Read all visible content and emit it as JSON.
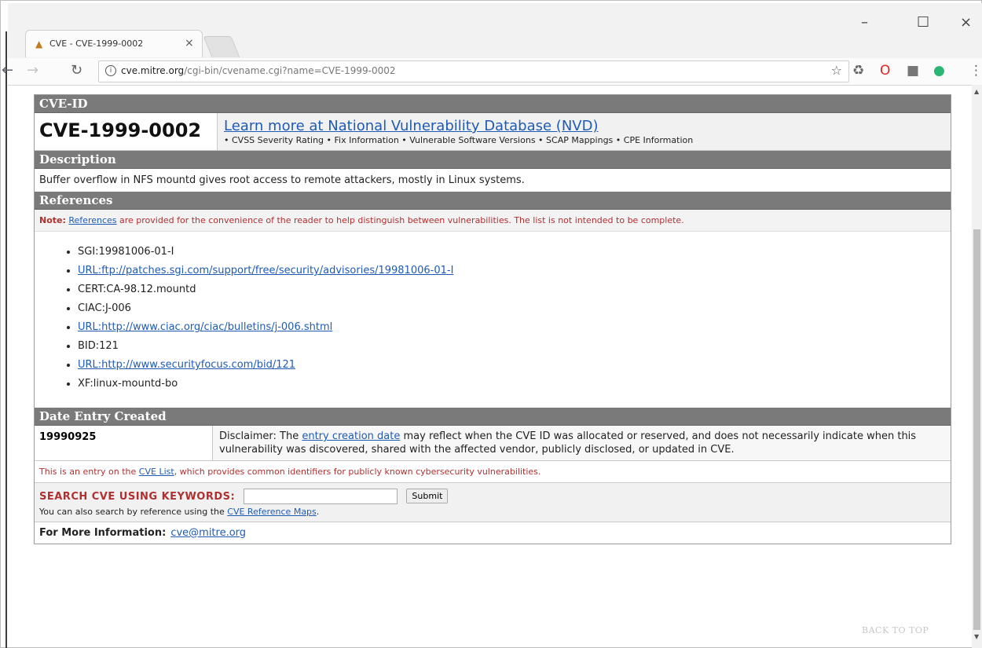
{
  "browser": {
    "tab_title": "CVE - CVE-1999-0002",
    "tab_close": "×",
    "url_host": "cve.mitre.org",
    "url_path": "/cgi-bin/cvename.cgi?name=CVE-1999-0002",
    "minimize": "–",
    "maximize": "☐",
    "close": "×"
  },
  "cve": {
    "section_id": "CVE-ID",
    "id": "CVE-1999-0002",
    "nvd_link": "Learn more at National Vulnerability Database (NVD)",
    "nvd_sub": "• CVSS Severity Rating • Fix Information • Vulnerable Software Versions • SCAP Mappings • CPE Information",
    "section_description": "Description",
    "description": "Buffer overflow in NFS mountd gives root access to remote attackers, mostly in Linux systems.",
    "section_references": "References",
    "note_label": "Note:",
    "note_link": "References",
    "note_text": " are provided for the convenience of the reader to help distinguish between vulnerabilities. The list is not intended to be complete.",
    "references": [
      {
        "text": "SGI:19981006-01-I",
        "link": false
      },
      {
        "text": "URL:ftp://patches.sgi.com/support/free/security/advisories/19981006-01-I",
        "link": true
      },
      {
        "text": "CERT:CA-98.12.mountd",
        "link": false
      },
      {
        "text": "CIAC:J-006",
        "link": false
      },
      {
        "text": "URL:http://www.ciac.org/ciac/bulletins/j-006.shtml",
        "link": true
      },
      {
        "text": "BID:121",
        "link": false
      },
      {
        "text": "URL:http://www.securityfocus.com/bid/121",
        "link": true
      },
      {
        "text": "XF:linux-mountd-bo",
        "link": false
      }
    ],
    "section_date": "Date Entry Created",
    "date": "19990925",
    "disclaimer_pre": "Disclaimer: The ",
    "disclaimer_link": "entry creation date",
    "disclaimer_post": " may reflect when the CVE ID was allocated or reserved, and does not necessarily indicate when this vulnerability was discovered, shared with the affected vendor, publicly disclosed, or updated in CVE.",
    "entry_pre": "This is an entry on the ",
    "entry_link": "CVE List",
    "entry_post": ", which provides common identifiers for publicly known cybersecurity vulnerabilities.",
    "search_title": "SEARCH CVE USING KEYWORDS:",
    "search_button": "Submit",
    "search_sub_pre": "You can also search by reference using the ",
    "search_sub_link": "CVE Reference Maps",
    "search_sub_post": ".",
    "more_info_label": "For More Information:",
    "more_info_email": "cve@mitre.org",
    "back_to_top": "BACK TO TOP"
  }
}
